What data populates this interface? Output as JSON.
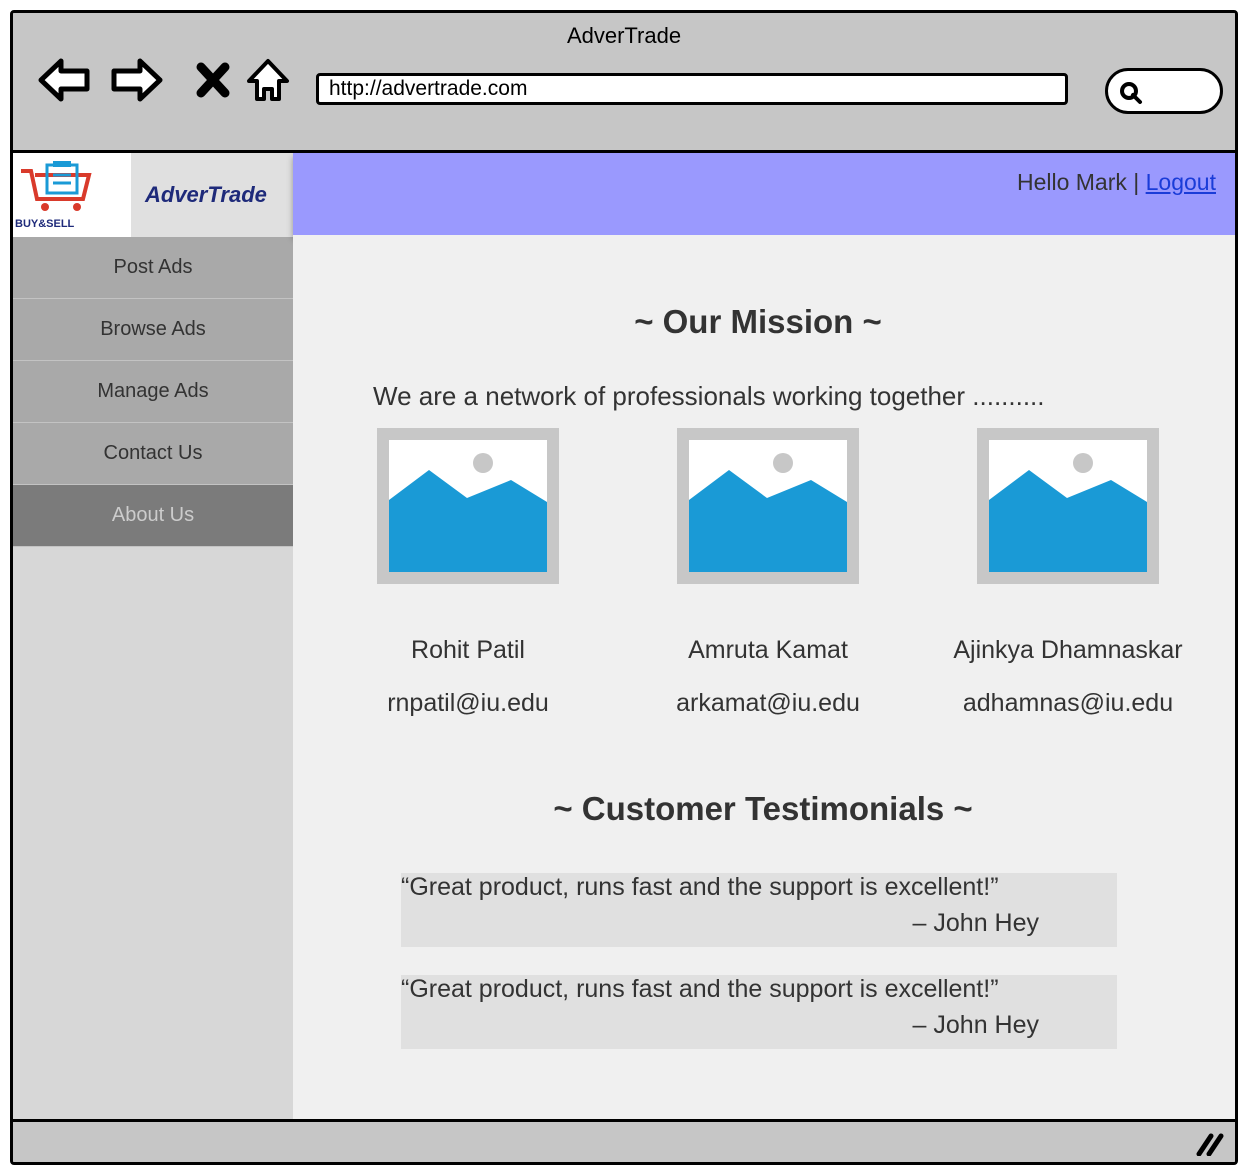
{
  "window": {
    "title": "AdverTrade"
  },
  "browser": {
    "url": "http://advertrade.com",
    "icons": [
      "back-arrow-icon",
      "forward-arrow-icon",
      "close-icon",
      "home-icon",
      "search-icon"
    ]
  },
  "logo": {
    "brand": "AdverTrade",
    "logo_text": "BUY&SELL"
  },
  "sidebar": {
    "items": [
      {
        "label": "Post Ads"
      },
      {
        "label": "Browse Ads"
      },
      {
        "label": "Manage Ads"
      },
      {
        "label": "Contact Us"
      },
      {
        "label": "About Us",
        "active": true
      }
    ]
  },
  "header": {
    "greeting": "Hello  Mark |",
    "logout_label": "Logout"
  },
  "mission": {
    "heading": "~ Our Mission ~",
    "intro": "We are a network of professionals working together ..........",
    "members": [
      {
        "name": "Rohit Patil",
        "email": "rnpatil@iu.edu"
      },
      {
        "name": "Amruta Kamat",
        "email": "arkamat@iu.edu"
      },
      {
        "name": "Ajinkya Dhamnaskar",
        "email": "adhamnas@iu.edu"
      }
    ]
  },
  "testimonials": {
    "heading": "~ Customer Testimonials ~",
    "items": [
      {
        "quote": "“Great product, runs fast and the support is excellent!”",
        "author": "– John Hey"
      },
      {
        "quote": "“Great product, runs fast and the support is excellent!”",
        "author": "– John Hey"
      }
    ]
  },
  "colors": {
    "header_bg": "#9a99fe",
    "menu_bg": "#a9a9a9",
    "menu_active_bg": "#7b7b7b",
    "image_blue": "#1a9ad6"
  }
}
